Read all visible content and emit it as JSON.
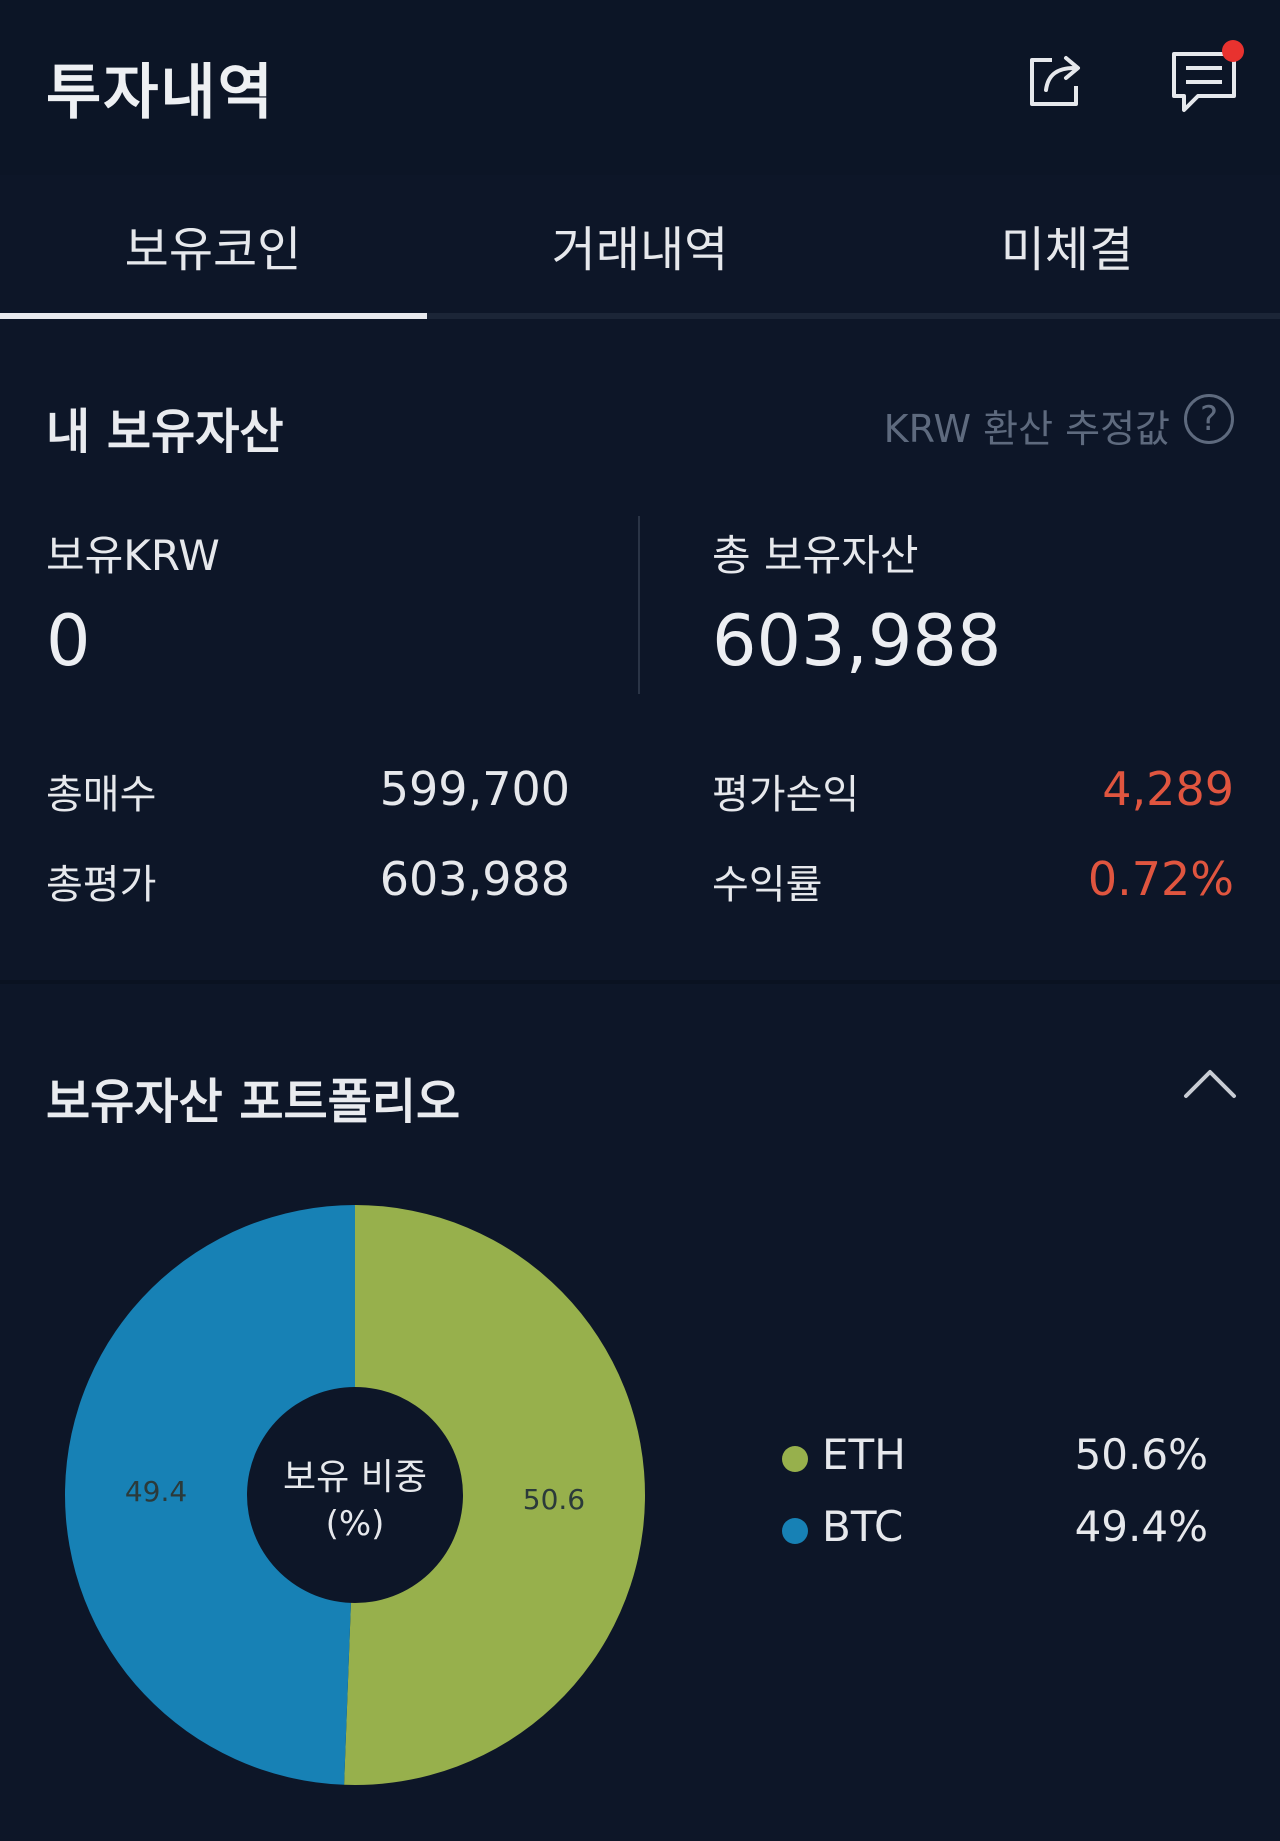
{
  "header": {
    "title": "투자내역",
    "share_icon": "share-icon",
    "chat_icon": "chat-icon",
    "notification_color": "#e8322f"
  },
  "tabs": [
    {
      "label": "보유코인",
      "active": true
    },
    {
      "label": "거래내역",
      "active": false
    },
    {
      "label": "미체결",
      "active": false
    }
  ],
  "assets": {
    "title": "내 보유자산",
    "krw_note": "KRW 환산 추정값",
    "help_symbol": "?",
    "krw_label": "보유KRW",
    "krw_value": "0",
    "total_label": "총 보유자산",
    "total_value": "603,988",
    "total_buy_label": "총매수",
    "total_buy_value": "599,700",
    "pnl_label": "평가손익",
    "pnl_value": "4,289",
    "total_eval_label": "총평가",
    "total_eval_value": "603,988",
    "return_label": "수익률",
    "return_value": "0.72%",
    "gain_color": "#e0553f"
  },
  "portfolio": {
    "title": "보유자산 포트폴리오",
    "collapse_icon": "chevron-up-icon",
    "center_label_line1": "보유 비중",
    "center_label_line2": "(%)",
    "legend": [
      {
        "name": "ETH",
        "pct": "50.6%",
        "color": "#97b04c"
      },
      {
        "name": "BTC",
        "pct": "49.4%",
        "color": "#1781b5"
      }
    ]
  },
  "chart_data": {
    "type": "pie",
    "categories": [
      "ETH",
      "BTC"
    ],
    "values": [
      50.6,
      49.4
    ],
    "labels": [
      "50.6",
      "49.4"
    ],
    "colors": [
      "#97b04c",
      "#1781b5"
    ]
  }
}
